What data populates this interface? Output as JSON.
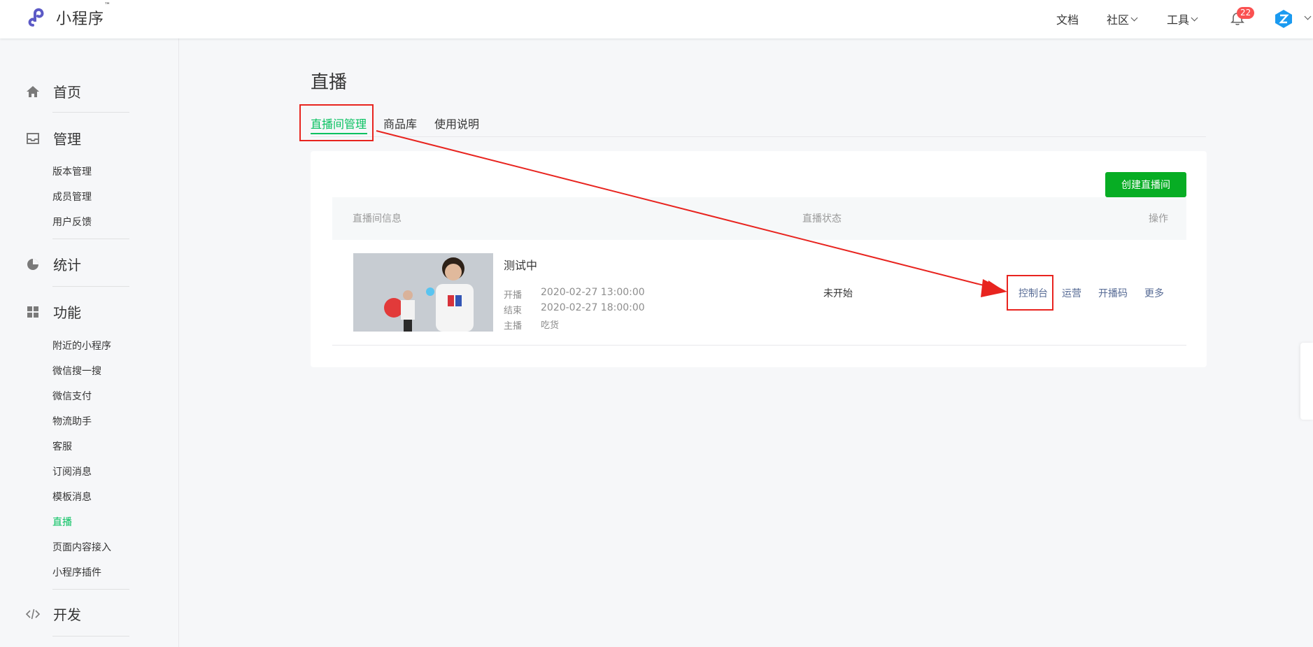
{
  "topbar": {
    "logo_text": "小程序",
    "logo_tm": "™",
    "nav": [
      {
        "label": "文档"
      },
      {
        "label": "社区"
      },
      {
        "label": "工具"
      }
    ],
    "notification_count": "22"
  },
  "sidebar": {
    "groups": [
      {
        "title": "首页",
        "icon": "home-icon",
        "items": []
      },
      {
        "title": "管理",
        "icon": "inbox-icon",
        "items": [
          "版本管理",
          "成员管理",
          "用户反馈"
        ]
      },
      {
        "title": "统计",
        "icon": "pie-chart-icon",
        "items": []
      },
      {
        "title": "功能",
        "icon": "grid-icon",
        "items": [
          "附近的小程序",
          "微信搜一搜",
          "微信支付",
          "物流助手",
          "客服",
          "订阅消息",
          "模板消息",
          "直播",
          "页面内容接入",
          "小程序插件"
        ]
      },
      {
        "title": "开发",
        "icon": "code-icon",
        "items": []
      }
    ],
    "active_item": "直播"
  },
  "main": {
    "title": "直播",
    "tabs": [
      {
        "label": "直播间管理",
        "active": true
      },
      {
        "label": "商品库",
        "active": false
      },
      {
        "label": "使用说明",
        "active": false
      }
    ],
    "create_button": "创建直播间",
    "table": {
      "headers": {
        "info": "直播间信息",
        "status": "直播状态",
        "ops": "操作"
      },
      "rows": [
        {
          "name": "测试中",
          "start_label": "开播",
          "start_time": "2020-02-27 13:00:00",
          "end_label": "结束",
          "end_time": "2020-02-27 18:00:00",
          "host_label": "主播",
          "host": "吃货",
          "status": "未开始",
          "actions": [
            "控制台",
            "运营",
            "开播码",
            "更多"
          ]
        }
      ]
    }
  },
  "colors": {
    "accent_green": "#07c160",
    "button_green": "#07ad24",
    "link_blue": "#576b95",
    "annotation_red": "#e8241f",
    "badge_red": "#fa5151"
  }
}
